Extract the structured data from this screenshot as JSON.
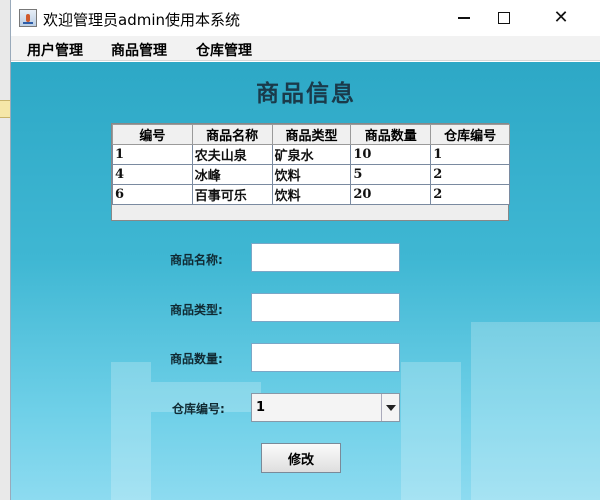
{
  "window": {
    "title": "欢迎管理员admin使用本系统"
  },
  "menu": [
    "用户管理",
    "商品管理",
    "仓库管理"
  ],
  "heading": "商品信息",
  "table": {
    "columns": [
      "编号",
      "商品名称",
      "商品类型",
      "商品数量",
      "仓库编号"
    ],
    "rows": [
      [
        "1",
        "农夫山泉",
        "矿泉水",
        "10",
        "1"
      ],
      [
        "4",
        "冰峰",
        "饮料",
        "5",
        "2"
      ],
      [
        "6",
        "百事可乐",
        "饮料",
        "20",
        "2"
      ]
    ]
  },
  "form": {
    "name_label": "商品名称:",
    "type_label": "商品类型:",
    "qty_label": "商品数量:",
    "warehouse_label": "仓库编号:",
    "name_value": "",
    "type_value": "",
    "qty_value": "",
    "warehouse_value": "1",
    "submit_label": "修改"
  }
}
